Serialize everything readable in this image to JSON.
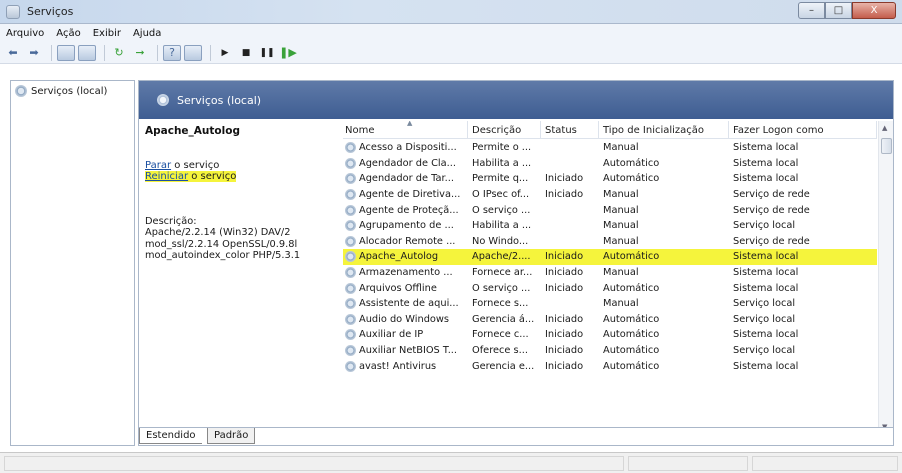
{
  "window": {
    "title": "Serviços",
    "controls": [
      "–",
      "□",
      "X"
    ]
  },
  "menu": [
    "Arquivo",
    "Ação",
    "Exibir",
    "Ajuda"
  ],
  "toolbar": [
    "back-icon",
    "forward-icon",
    "console-tree-icon",
    "properties-icon",
    "refresh-icon",
    "export-icon",
    "help-icon",
    "view-icon",
    "play-icon",
    "stop-icon",
    "pause-icon",
    "restart-icon"
  ],
  "tree": {
    "root": "Serviços (local)"
  },
  "header": {
    "title": "Serviços (local)"
  },
  "details": {
    "service_name": "Apache_Autolog",
    "stop_link": "Parar",
    "stop_suffix": " o serviço",
    "restart_link": "Reiniciar",
    "restart_suffix": " o serviço",
    "description_label": "Descrição:",
    "description": "Apache/2.2.14 (Win32) DAV/2\nmod_ssl/2.2.14 OpenSSL/0.9.8l\nmod_autoindex_color PHP/5.3.1"
  },
  "table": {
    "columns": [
      "Nome",
      "Descrição",
      "Status",
      "Tipo de Inicialização",
      "Fazer Logon como"
    ],
    "rows": [
      [
        "Acesso a Dispositi...",
        "Permite o ...",
        "",
        "Manual",
        "Sistema local"
      ],
      [
        "Agendador de Cla...",
        "Habilita a ...",
        "",
        "Automático",
        "Sistema local"
      ],
      [
        "Agendador de Tar...",
        "Permite q...",
        "Iniciado",
        "Automático",
        "Sistema local"
      ],
      [
        "Agente de Diretiva...",
        "O IPsec of...",
        "Iniciado",
        "Manual",
        "Serviço de rede"
      ],
      [
        "Agente de Proteçã...",
        "O serviço ...",
        "",
        "Manual",
        "Serviço de rede"
      ],
      [
        "Agrupamento de ...",
        "Habilita a ...",
        "",
        "Manual",
        "Serviço local"
      ],
      [
        "Alocador Remote ...",
        "No Windo...",
        "",
        "Manual",
        "Serviço de rede"
      ],
      [
        "Apache_Autolog",
        "Apache/2....",
        "Iniciado",
        "Automático",
        "Sistema local"
      ],
      [
        "Armazenamento ...",
        "Fornece ar...",
        "Iniciado",
        "Manual",
        "Sistema local"
      ],
      [
        "Arquivos Offline",
        "O serviço ...",
        "Iniciado",
        "Automático",
        "Sistema local"
      ],
      [
        "Assistente de aqui...",
        "Fornece s...",
        "",
        "Manual",
        "Serviço local"
      ],
      [
        "Áudio do Windows",
        "Gerencia á...",
        "Iniciado",
        "Automático",
        "Serviço local"
      ],
      [
        "Auxiliar de IP",
        "Fornece c...",
        "Iniciado",
        "Automático",
        "Sistema local"
      ],
      [
        "Auxiliar NetBIOS T...",
        "Oferece s...",
        "Iniciado",
        "Automático",
        "Serviço local"
      ],
      [
        "avast! Antivirus",
        "Gerencia e...",
        "Iniciado",
        "Automático",
        "Sistema local"
      ]
    ],
    "selected_row": 7
  },
  "tabs": [
    "Estendido",
    "Padrão"
  ],
  "colors": {
    "highlight": "#f5f43c",
    "header_bg": "#4a6a9c",
    "link": "#1a4fa0"
  }
}
